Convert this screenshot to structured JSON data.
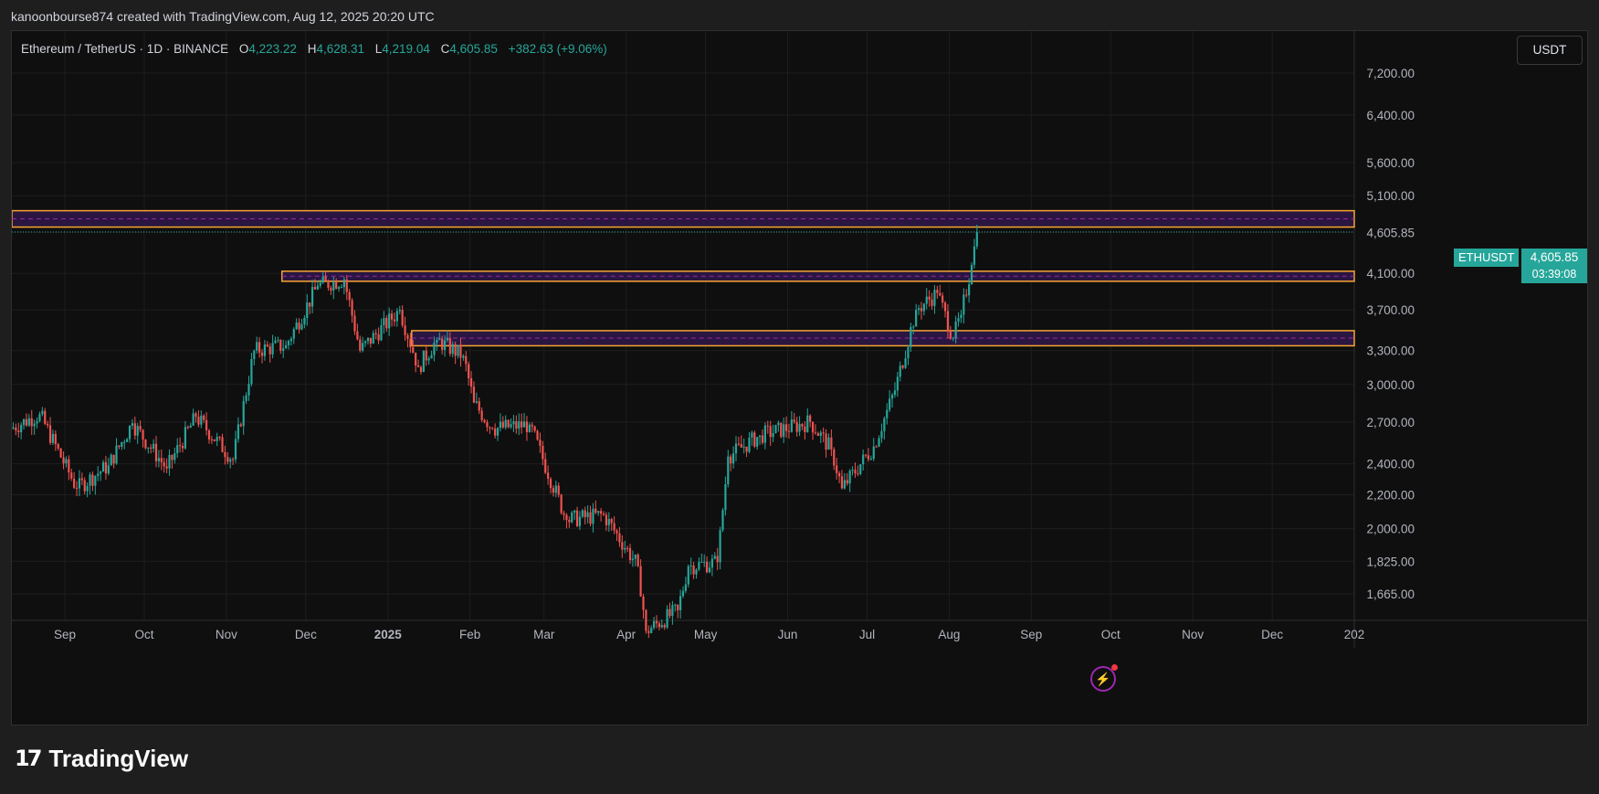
{
  "caption": "kanoonbourse874 created with TradingView.com, Aug 12, 2025 20:20 UTC",
  "legend": {
    "symbol": "Ethereum / TetherUS · 1D · BINANCE",
    "open_label": "O",
    "open": "4,223.22",
    "high_label": "H",
    "high": "4,628.31",
    "low_label": "L",
    "low": "4,219.04",
    "close_label": "C",
    "close": "4,605.85",
    "change": "+382.63 (+9.06%)"
  },
  "currency_button": "USDT",
  "price_tag": {
    "symbol": "ETHUSDT",
    "price": "4,605.85",
    "countdown": "03:39:08"
  },
  "logo_text": "TradingView",
  "colors": {
    "up": "#26a69a",
    "down": "#ef5350",
    "zone_border": "#f7a531",
    "zone_fill": "#2a1640",
    "zone_mid": "#9c27b0"
  },
  "chart_data": {
    "type": "candlestick",
    "scale": "log",
    "y_ticks": [
      7200,
      6400,
      5600,
      5100,
      4600,
      4100,
      3700,
      3300,
      3000,
      2700,
      2400,
      2200,
      2000,
      1825,
      1665
    ],
    "y_tick_labels": [
      "7,200.00",
      "6,400.00",
      "5,600.00",
      "5,100.00",
      "4,605.85",
      "4,100.00",
      "3,700.00",
      "3,300.00",
      "3,000.00",
      "2,700.00",
      "2,400.00",
      "2,200.00",
      "2,000.00",
      "1,825.00",
      "1,665.00"
    ],
    "x_axis_labels": [
      {
        "date": "2024-09-01",
        "label": "Sep"
      },
      {
        "date": "2024-10-01",
        "label": "Oct"
      },
      {
        "date": "2024-11-01",
        "label": "Nov"
      },
      {
        "date": "2024-12-01",
        "label": "Dec"
      },
      {
        "date": "2025-01-01",
        "label": "2025",
        "bold": true
      },
      {
        "date": "2025-02-01",
        "label": "Feb"
      },
      {
        "date": "2025-03-01",
        "label": "Mar"
      },
      {
        "date": "2025-04-01",
        "label": "Apr"
      },
      {
        "date": "2025-05-01",
        "label": "May"
      },
      {
        "date": "2025-06-01",
        "label": "Jun"
      },
      {
        "date": "2025-07-01",
        "label": "Jul"
      },
      {
        "date": "2025-08-01",
        "label": "Aug"
      },
      {
        "date": "2025-09-01",
        "label": "Sep"
      },
      {
        "date": "2025-10-01",
        "label": "Oct"
      },
      {
        "date": "2025-11-01",
        "label": "Nov"
      },
      {
        "date": "2025-12-01",
        "label": "Dec"
      },
      {
        "date": "2026-01-01",
        "label": "202"
      }
    ],
    "x_range": [
      "2024-08-12",
      "2026-01-01"
    ],
    "current_price": 4605.85,
    "zones": [
      {
        "top": 4890,
        "bottom": 4670,
        "mid": 4780,
        "start": "2024-08-12"
      },
      {
        "top": 4125,
        "bottom": 4010,
        "mid": 4068,
        "start": "2024-11-22"
      },
      {
        "top": 3490,
        "bottom": 3345,
        "mid": 3418,
        "start": "2025-01-10"
      }
    ],
    "price_path": [
      {
        "date": "2024-08-12",
        "close": 2650
      },
      {
        "date": "2024-08-23",
        "close": 2760
      },
      {
        "date": "2024-09-06",
        "close": 2240
      },
      {
        "date": "2024-09-18",
        "close": 2390
      },
      {
        "date": "2024-09-27",
        "close": 2690
      },
      {
        "date": "2024-10-10",
        "close": 2370
      },
      {
        "date": "2024-10-21",
        "close": 2740
      },
      {
        "date": "2024-11-04",
        "close": 2430
      },
      {
        "date": "2024-11-12",
        "close": 3300
      },
      {
        "date": "2024-11-24",
        "close": 3350
      },
      {
        "date": "2024-12-06",
        "close": 3960
      },
      {
        "date": "2024-12-16",
        "close": 4030
      },
      {
        "date": "2024-12-22",
        "close": 3300
      },
      {
        "date": "2025-01-06",
        "close": 3700
      },
      {
        "date": "2025-01-13",
        "close": 3150
      },
      {
        "date": "2025-01-20",
        "close": 3400
      },
      {
        "date": "2025-01-30",
        "close": 3250
      },
      {
        "date": "2025-02-03",
        "close": 2850
      },
      {
        "date": "2025-02-10",
        "close": 2650
      },
      {
        "date": "2025-02-24",
        "close": 2680
      },
      {
        "date": "2025-03-10",
        "close": 2050
      },
      {
        "date": "2025-03-24",
        "close": 2080
      },
      {
        "date": "2025-04-06",
        "close": 1800
      },
      {
        "date": "2025-04-09",
        "close": 1500
      },
      {
        "date": "2025-04-21",
        "close": 1590
      },
      {
        "date": "2025-04-25",
        "close": 1800
      },
      {
        "date": "2025-05-06",
        "close": 1820
      },
      {
        "date": "2025-05-10",
        "close": 2450
      },
      {
        "date": "2025-05-22",
        "close": 2600
      },
      {
        "date": "2025-06-10",
        "close": 2700
      },
      {
        "date": "2025-06-18",
        "close": 2500
      },
      {
        "date": "2025-06-22",
        "close": 2240
      },
      {
        "date": "2025-07-04",
        "close": 2520
      },
      {
        "date": "2025-07-12",
        "close": 2950
      },
      {
        "date": "2025-07-20",
        "close": 3700
      },
      {
        "date": "2025-07-28",
        "close": 3880
      },
      {
        "date": "2025-08-03",
        "close": 3420
      },
      {
        "date": "2025-08-06",
        "close": 3650
      },
      {
        "date": "2025-08-10",
        "close": 4200
      },
      {
        "date": "2025-08-12",
        "close": 4605.85
      }
    ]
  }
}
